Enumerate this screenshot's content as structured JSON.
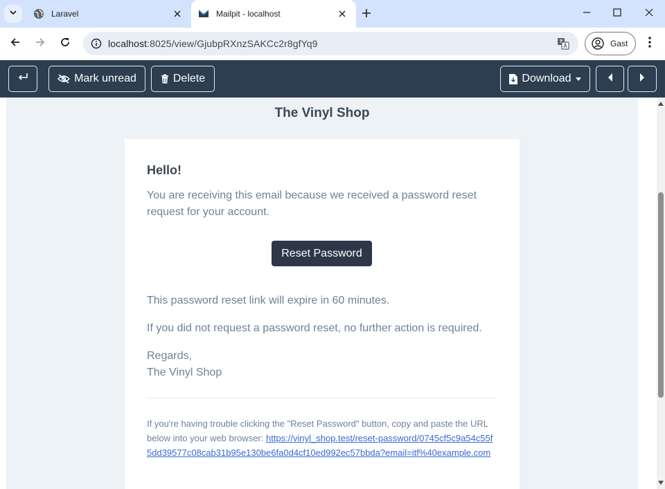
{
  "browser": {
    "tabs": [
      {
        "title": "Laravel",
        "active": false,
        "icon": "globe-icon"
      },
      {
        "title": "Mailpit - localhost",
        "active": true,
        "icon": "mailpit-icon"
      }
    ],
    "url_host": "localhost",
    "url_path": ":8025/view/GjubpRXnzSAKCc2r8gfYq9",
    "profile_label": "Gast"
  },
  "mailpit": {
    "mark_unread_label": "Mark unread",
    "delete_label": "Delete",
    "download_label": "Download",
    "nav_bg": "#2c3e50"
  },
  "email": {
    "brand": "The Vinyl Shop",
    "greeting": "Hello!",
    "intro": "You are receiving this email because we received a password reset request for your account.",
    "button_label": "Reset Password",
    "expire_line": "This password reset link will expire in 60 minutes.",
    "no_action_line": "If you did not request a password reset, no further action is required.",
    "regards": "Regards,",
    "signature": "The Vinyl Shop",
    "subcopy_text": "If you're having trouble clicking the \"Reset Password\" button, copy and paste the URL below into your web browser: ",
    "reset_url": "https://vinyl_shop.test/reset-password/0745cf5c9a54c55f5dd39577c08cab31b95e130be6fa0d4cf10ed992ec57bbda?email=itf%40example.com"
  }
}
